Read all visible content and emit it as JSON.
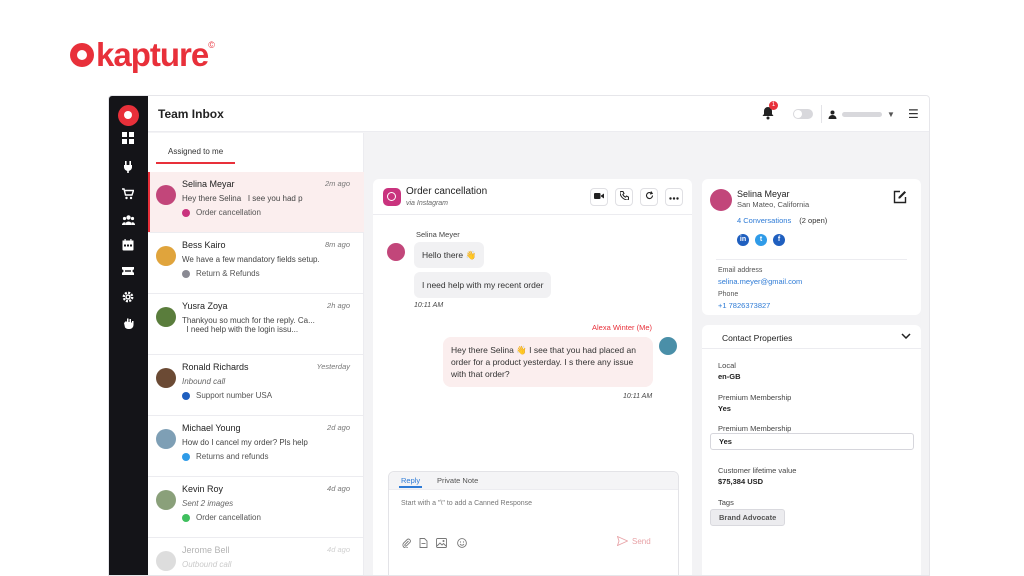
{
  "brand": {
    "name": "kapture",
    "reg_mark": "©",
    "color": "#e8303a"
  },
  "topbar": {
    "title": "Team Inbox",
    "notification_count": "1"
  },
  "rail": {
    "icons": [
      "dashboard-icon",
      "plug-icon",
      "cart-icon",
      "team-icon",
      "calendar-icon",
      "ticket-icon",
      "settings-icon",
      "hand-icon"
    ]
  },
  "inbox": {
    "tab_label": "Assigned to me",
    "conversations": [
      {
        "name": "Selina Meyar",
        "time": "2m ago",
        "preview": "Hey there Selina   I see you had p",
        "channel": "Order cancellation",
        "channel_icon": "instagram-icon",
        "channel_color": "#c9337e",
        "avatar_color": "#c2467a",
        "italic": false,
        "active": true
      },
      {
        "name": "Bess Kairo",
        "time": "8m ago",
        "preview": "We have a few mandatory fields setup.",
        "channel": "Return & Refunds",
        "channel_icon": "globe-icon",
        "channel_color": "#8a8a93",
        "avatar_color": "#e0a43c",
        "italic": false,
        "active": false
      },
      {
        "name": "Yusra Zoya",
        "time": "2h ago",
        "preview": "Thankyou so much for the reply. Ca...\n  I need help with the login issu...",
        "channel": "",
        "channel_icon": "",
        "channel_color": "",
        "avatar_color": "#5a7d3c",
        "italic": false,
        "active": false
      },
      {
        "name": "Ronald Richards",
        "time": "Yesterday",
        "preview": "Inbound call",
        "channel": "Support number USA",
        "channel_icon": "facebook-icon",
        "channel_color": "#1f5fbf",
        "avatar_color": "#6b4a34",
        "italic": true,
        "active": false
      },
      {
        "name": "Michael Young",
        "time": "2d ago",
        "preview": "How do I cancel my order? Pls help",
        "channel": "Returns and refunds",
        "channel_icon": "twitter-icon",
        "channel_color": "#2f9be8",
        "avatar_color": "#7e9fb5",
        "italic": false,
        "active": false
      },
      {
        "name": "Kevin Roy",
        "time": "4d ago",
        "preview": "Sent 2 images",
        "channel": "Order cancellation",
        "channel_icon": "whatsapp-icon",
        "channel_color": "#3fbf5e",
        "avatar_color": "#8aa07a",
        "italic": true,
        "active": false
      },
      {
        "name": "Jerome Bell",
        "time": "4d ago",
        "preview": "Outbound call",
        "channel": "",
        "channel_icon": "",
        "channel_color": "",
        "avatar_color": "#a0a0a0",
        "italic": true,
        "active": false,
        "faded": true
      }
    ]
  },
  "chat": {
    "title": "Order cancellation",
    "subtitle": "via Instagram",
    "actions": [
      "video-icon",
      "phone-icon",
      "refresh-icon",
      "more-icon"
    ],
    "incoming_sender": "Selina Meyer",
    "incoming_messages": [
      "Hello there 👋",
      "I need help with my recent order"
    ],
    "incoming_time": "10:11 AM",
    "outgoing_sender": "Alexa Winter (Me)",
    "outgoing_message": "Hey there Selina 👋 I see that you had placed an order for a product yesterday. I s there any issue with that order?",
    "outgoing_time": "10:11 AM",
    "composer": {
      "tab_reply": "Reply",
      "tab_private": "Private Note",
      "placeholder": "Start with a \"\\\" to add a Canned Response",
      "send_label": "Send"
    }
  },
  "profile": {
    "name": "Selina Meyar",
    "location": "San Mateo, California",
    "conversations_link": "4 Conversations",
    "open_count": "(2 open)",
    "email_label": "Email address",
    "email": "selina.meyer@gmail.com",
    "phone_label": "Phone",
    "phone": "+1 7826373827",
    "socials": [
      {
        "icon": "linkedin-icon",
        "glyph": "in",
        "color": "#1f5fbf"
      },
      {
        "icon": "twitter-icon",
        "glyph": "t",
        "color": "#2f9be8"
      },
      {
        "icon": "facebook-icon",
        "glyph": "f",
        "color": "#1f5fbf"
      }
    ]
  },
  "contact_properties": {
    "title": "Contact Properties",
    "local_label": "Local",
    "local_value": "en-GB",
    "premium_label": "Premium Membership",
    "premium_value": "Yes",
    "premium_input_label": "Premium Membership",
    "premium_input_value": "Yes",
    "clv_label": "Customer lifetime value",
    "clv_value": "$75,384 USD",
    "tags_label": "Tags",
    "tag": "Brand Advocate"
  }
}
